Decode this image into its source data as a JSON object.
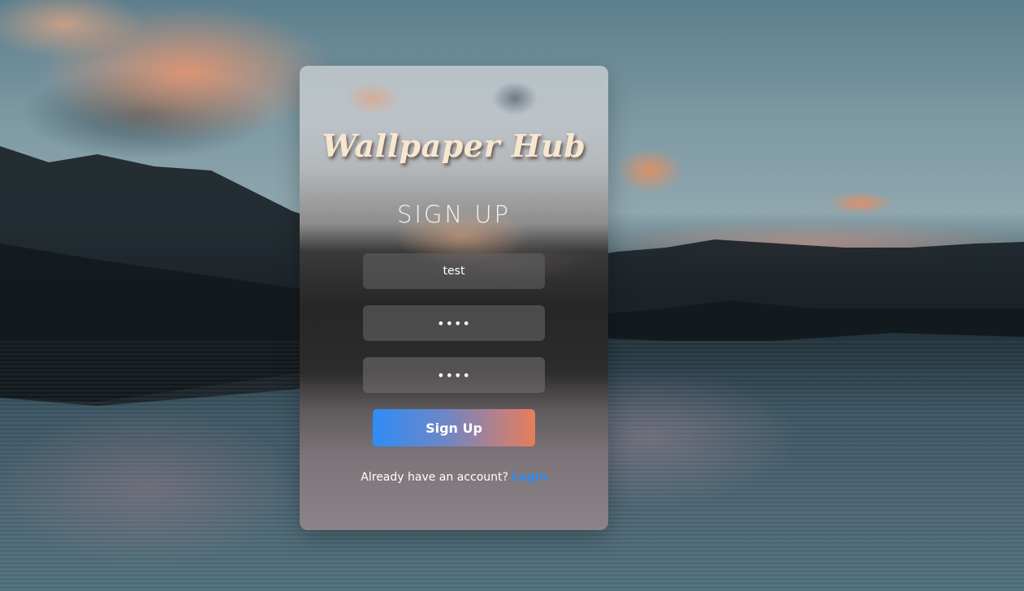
{
  "app": {
    "brand": "Wallpaper Hub"
  },
  "form": {
    "heading": "SIGN UP",
    "fields": [
      {
        "type": "text",
        "value": "test"
      },
      {
        "type": "password",
        "value": "test"
      },
      {
        "type": "password",
        "value": "test"
      }
    ],
    "submit_label": "Sign Up",
    "footer_text": "Already have an account?",
    "footer_link": "Login"
  },
  "colors": {
    "brand_text": "#f7e7d0",
    "button_gradient_start": "#2f8cf5",
    "button_gradient_end": "#e87d5b",
    "link": "#2f8cf5"
  }
}
